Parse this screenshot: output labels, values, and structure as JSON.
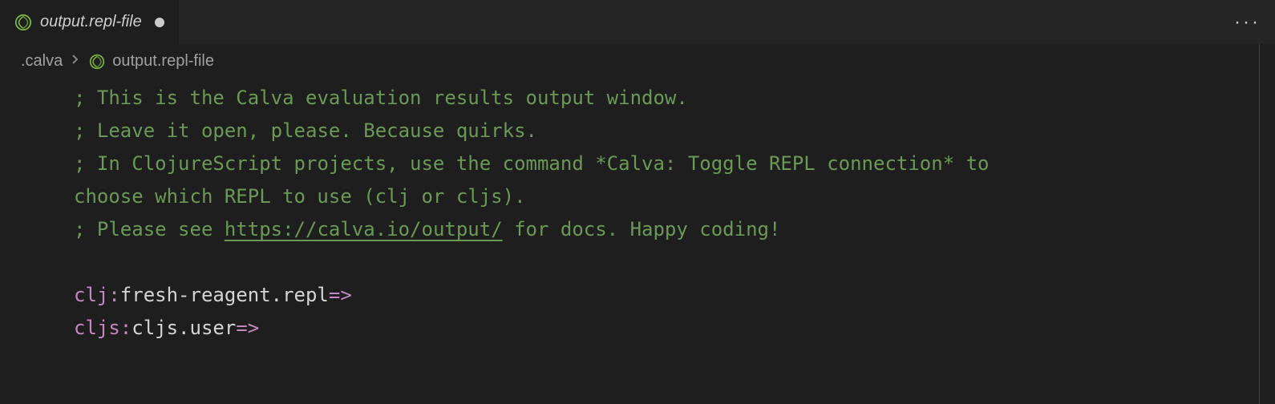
{
  "tab": {
    "label": "output.repl-file",
    "icon": "clojure-icon",
    "dirty": true
  },
  "breadcrumbs": {
    "folder": ".calva",
    "file": "output.repl-file"
  },
  "lines": {
    "l1_prefix": "; ",
    "l1_text": "This is the Calva evaluation results output window.",
    "l2_prefix": "; ",
    "l2_text": "Leave it open, please. Because quirks.",
    "l3_prefix": "; ",
    "l3_text_a": "In ClojureScript projects, use the command *Calva: Toggle REPL connection* to",
    "l4_text": "choose which REPL to use (clj or cljs).",
    "l5_prefix": "; ",
    "l5_text_a": "Please see ",
    "l5_link": "https://calva.io/output/",
    "l5_text_b": " for docs. Happy coding!",
    "prompt1_lang": "clj꞉",
    "prompt1_ns": "fresh-reagent.repl",
    "prompt1_arrow": "=>",
    "prompt2_lang": "cljs꞉",
    "prompt2_ns": "cljs.user",
    "prompt2_arrow": "=>"
  },
  "actions": {
    "ellipsis": "···"
  }
}
